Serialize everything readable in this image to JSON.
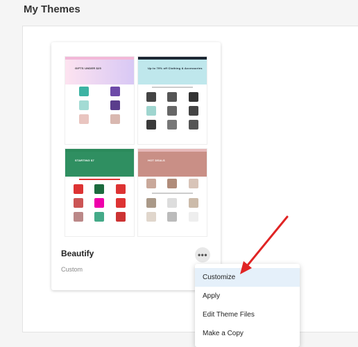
{
  "page": {
    "title": "My Themes"
  },
  "theme": {
    "name": "Beautify",
    "type": "Custom"
  },
  "previews": [
    {
      "headline": "GIFTS UNDER $25",
      "accent": "#f2b8d8",
      "hero": "#f7c9e8"
    },
    {
      "headline": "Up to 70% off Clothing & Accessories",
      "accent": "#1c2733",
      "hero": "#bfe7ec"
    },
    {
      "headline": "STARTING $7",
      "accent": "#2b8a5b",
      "hero": "#2f8f61"
    },
    {
      "headline": "HOT DEALS",
      "accent": "#e6b8b8",
      "hero": "#c98f86"
    }
  ],
  "more_button": {
    "label": "•••"
  },
  "menu": {
    "items": [
      {
        "label": "Customize",
        "active": true
      },
      {
        "label": "Apply",
        "active": false
      },
      {
        "label": "Edit Theme Files",
        "active": false
      },
      {
        "label": "Make a Copy",
        "active": false
      }
    ]
  },
  "colors": {
    "annotation_arrow": "#e02424",
    "menu_highlight": "#e5f0fa"
  }
}
